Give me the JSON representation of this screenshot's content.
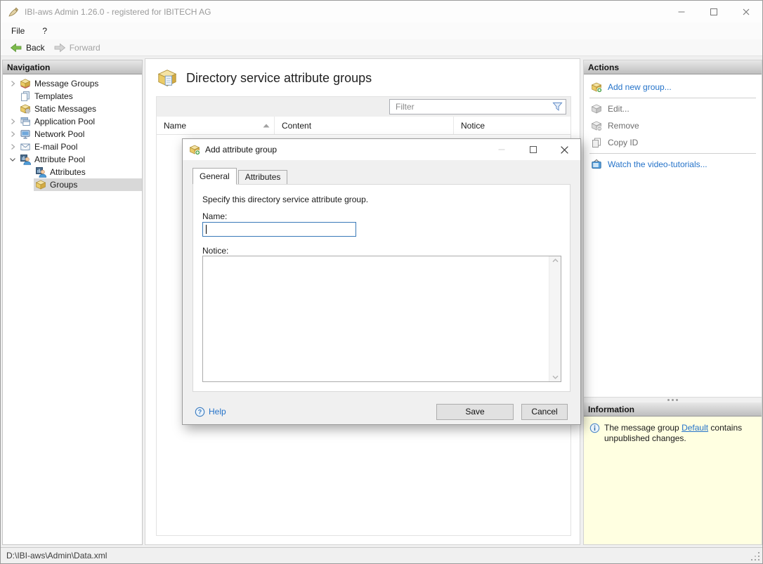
{
  "window": {
    "title": "IBI-aws Admin 1.26.0 - registered for IBITECH AG"
  },
  "menu": {
    "file": "File",
    "help": "?"
  },
  "toolbar": {
    "back": "Back",
    "forward": "Forward"
  },
  "navigation": {
    "header": "Navigation",
    "items": [
      {
        "label": "Message Groups"
      },
      {
        "label": "Templates"
      },
      {
        "label": "Static Messages"
      },
      {
        "label": "Application Pool"
      },
      {
        "label": "Network Pool"
      },
      {
        "label": "E-mail Pool"
      },
      {
        "label": "Attribute Pool"
      },
      {
        "label": "Attributes"
      },
      {
        "label": "Groups"
      }
    ]
  },
  "main": {
    "title": "Directory service attribute groups",
    "filter_placeholder": "Filter",
    "columns": {
      "name": "Name",
      "content": "Content",
      "notice": "Notice"
    },
    "rows": []
  },
  "actions": {
    "header": "Actions",
    "add_new_group": "Add new group...",
    "edit": "Edit...",
    "remove": "Remove",
    "copy_id": "Copy ID",
    "watch_tutorials": "Watch the video-tutorials..."
  },
  "information": {
    "header": "Information",
    "message_before": "The message group ",
    "message_link": "Default",
    "message_after": " contains unpublished changes."
  },
  "dialog": {
    "title": "Add attribute group",
    "tab_general": "General",
    "tab_attributes": "Attributes",
    "description": "Specify this directory service attribute group.",
    "name_label": "Name:",
    "name_value": "",
    "notice_label": "Notice:",
    "notice_value": "",
    "help_label": "Help",
    "save_label": "Save",
    "cancel_label": "Cancel"
  },
  "statusbar": {
    "path": "D:\\IBI-aws\\Admin\\Data.xml"
  },
  "colors": {
    "link": "#2573C9",
    "info_bg": "#FFFFE1",
    "focus_border": "#3979B8",
    "selection": "#D8D8D8"
  }
}
